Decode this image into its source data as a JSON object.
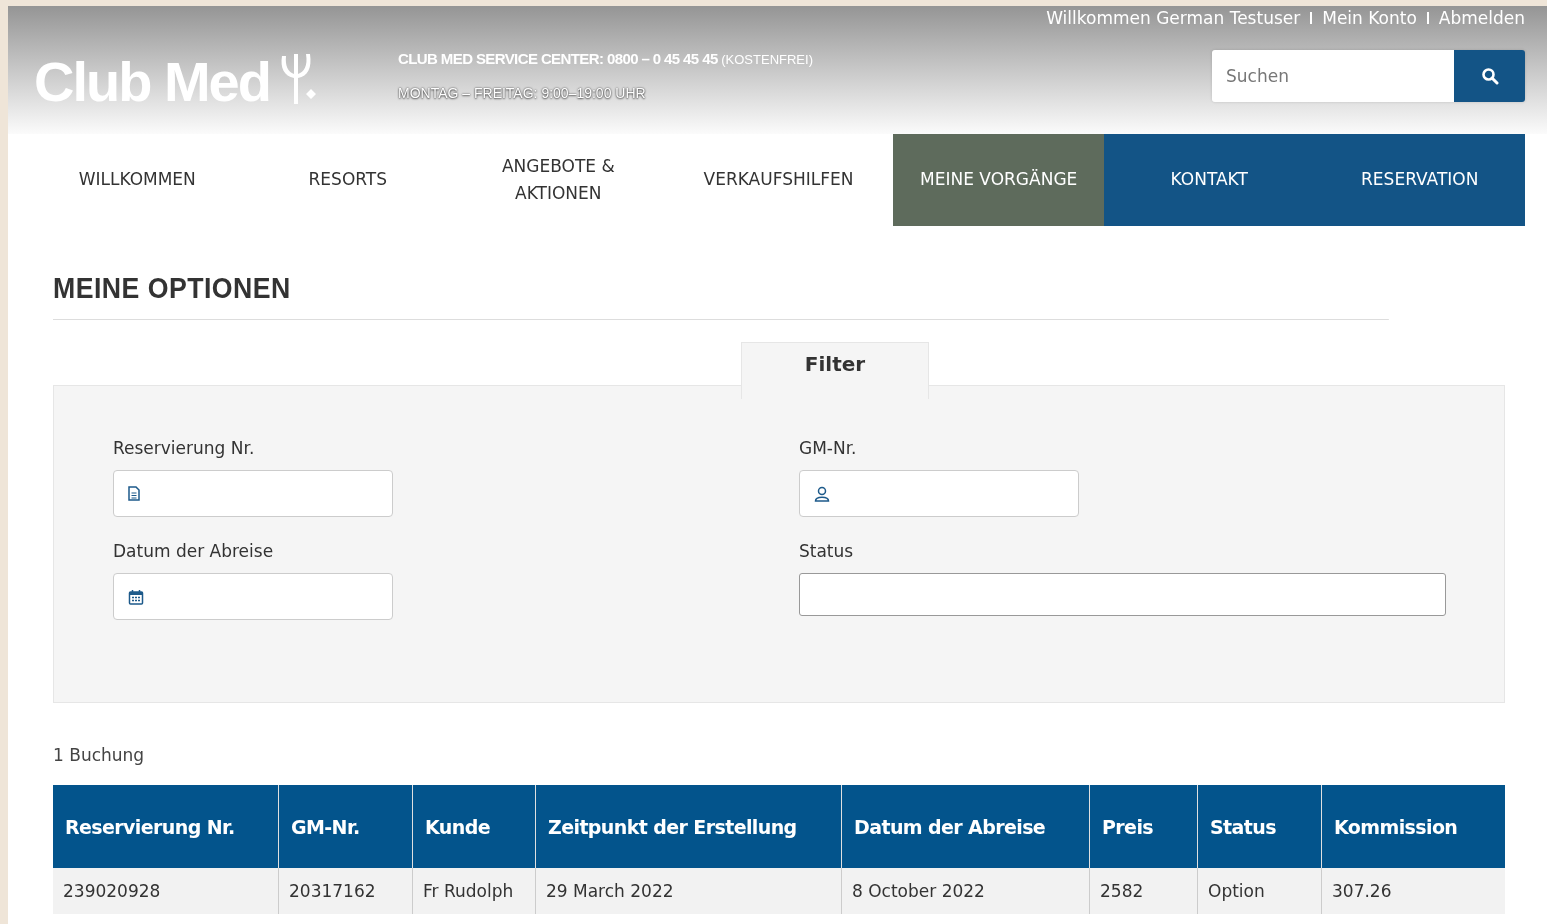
{
  "header": {
    "logo": "Club Med",
    "service_line": "CLUB MED SERVICE CENTER: 0800 – 0 45 45 45",
    "service_note": "(KOSTENFREI)",
    "hours": "MONTAG – FREITAG: 9:00–19:00 UHR",
    "user_links": [
      {
        "label": "Willkommen German Testuser"
      },
      {
        "label": "Mein Konto"
      },
      {
        "label": "Abmelden"
      }
    ],
    "search": {
      "placeholder": "Suchen"
    }
  },
  "nav": [
    {
      "label": "WILLKOMMEN",
      "kind": "plain",
      "selected": false
    },
    {
      "label": "RESORTS",
      "kind": "plain",
      "selected": false
    },
    {
      "label": "ANGEBOTE & AKTIONEN",
      "kind": "plain",
      "selected": false
    },
    {
      "label": "VERKAUFSHILFEN",
      "kind": "plain",
      "selected": false
    },
    {
      "label": "MEINE VORGÄNGE",
      "kind": "plain",
      "selected": true
    },
    {
      "label": "KONTAKT",
      "kind": "accent",
      "selected": false
    },
    {
      "label": "RESERVATION",
      "kind": "accent",
      "selected": false
    }
  ],
  "title": "MEINE OPTIONEN",
  "filter": {
    "tab": "Filter",
    "fields": [
      {
        "label": "Reservierung Nr.",
        "kind": "document"
      },
      {
        "label": "GM-Nr.",
        "kind": "person"
      },
      {
        "label": "Datum der Abreise",
        "kind": "calendar"
      },
      {
        "label": "Status",
        "kind": "select"
      }
    ]
  },
  "count": "1 Buchung",
  "table": {
    "columns": [
      "Reservierung Nr.",
      "GM-Nr.",
      "Kunde",
      "Zeitpunkt der Erstellung",
      "Datum der Abreise",
      "Preis",
      "Status",
      "Kommission"
    ],
    "rows": [
      [
        "239020928",
        "20317162",
        "Fr Rudolph",
        "29 March 2022",
        "8 October 2022",
        "2582",
        "Option",
        "307.26"
      ]
    ]
  }
}
